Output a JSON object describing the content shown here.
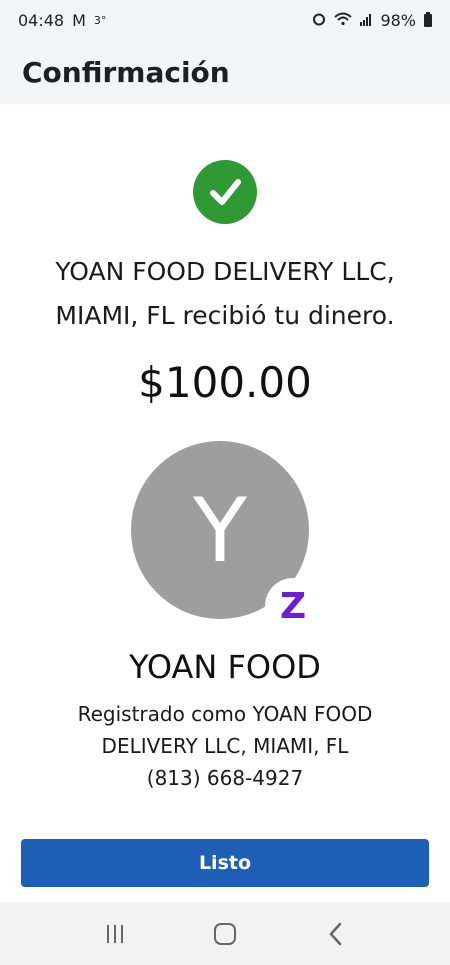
{
  "status_bar": {
    "time": "04:48",
    "mail_icon": "M",
    "small_status": "3°",
    "battery": "98%"
  },
  "header": {
    "title": "Confirmación"
  },
  "confirmation": {
    "message_line1": "YOAN FOOD DELIVERY LLC,",
    "message_line2": "MIAMI, FL recibió tu dinero.",
    "amount": "$100.00"
  },
  "recipient": {
    "avatar_initial": "Y",
    "badge_symbol": "Z",
    "name": "YOAN FOOD",
    "registered_line1": "Registrado como YOAN FOOD",
    "registered_line2": "DELIVERY LLC, MIAMI, FL",
    "phone": "(813) 668-4927"
  },
  "actions": {
    "done_label": "Listo"
  },
  "colors": {
    "success": "#2f9a34",
    "primary": "#1d5fb5",
    "zelle": "#6d1ed4",
    "avatar": "#9e9e9e"
  }
}
